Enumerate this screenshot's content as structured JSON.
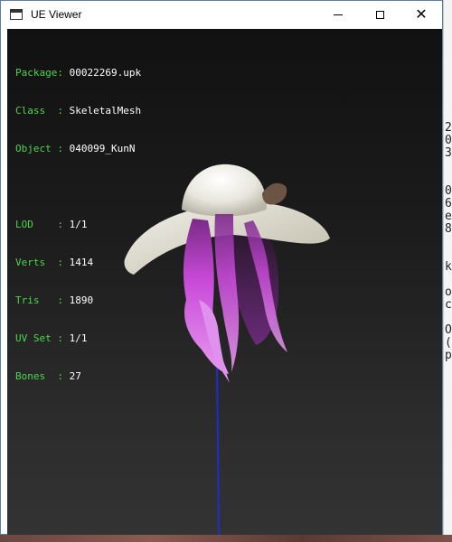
{
  "window": {
    "title": "UE Viewer",
    "controls": {
      "minimize_icon": "minimize-icon",
      "maximize_icon": "maximize-icon",
      "close_glyph": "✕"
    }
  },
  "info": {
    "package_label": "Package: ",
    "package_value": "00022269.upk",
    "class_label": "Class  : ",
    "class_value": "SkeletalMesh",
    "object_label": "Object : ",
    "object_value": "040099_KunN",
    "lod_label": "LOD    : ",
    "lod_value": "1/1",
    "verts_label": "Verts  : ",
    "verts_value": "1414",
    "tris_label": "Tris   : ",
    "tris_value": "1890",
    "uvset_label": "UV Set : ",
    "uvset_value": "1/1",
    "bones_label": "Bones  : ",
    "bones_value": "27"
  },
  "background_window_text": [
    "2",
    "0",
    "3",
    "",
    "0",
    "6",
    "e",
    "8",
    "",
    "",
    "k",
    "",
    "o",
    "c",
    "",
    "O",
    "(",
    "p"
  ],
  "colors": {
    "label_green": "#4cd64c",
    "value_white": "#ffffff",
    "hat_white": "#ecebe5",
    "hair_purple": "#c848d8",
    "bone_line_blue": "#1a2fd0"
  }
}
